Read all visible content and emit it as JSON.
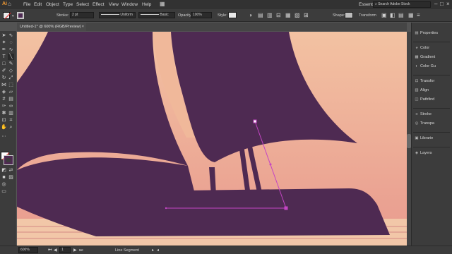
{
  "menubar": {
    "items": [
      "File",
      "Edit",
      "Object",
      "Type",
      "Select",
      "Effect",
      "View",
      "Window",
      "Help"
    ],
    "workspace": "Essentials",
    "search_placeholder": "Search Adobe Stock"
  },
  "control_bar": {
    "stroke_label": "Stroke:",
    "stroke_weight": "2 pt",
    "profile": "Uniform",
    "brush": "Basic",
    "opacity_label": "Opacity:",
    "opacity_value": "100%",
    "style_label": "Style:",
    "shape_label": "Shape:",
    "transform_label": "Transform"
  },
  "document": {
    "tab_title": "Untitled-1* @ 600% (RGB/Preview)"
  },
  "panels": {
    "items": [
      {
        "icon": "properties-icon",
        "label": "Properties"
      },
      {
        "icon": "color-icon",
        "label": "Color"
      },
      {
        "icon": "gradient-icon",
        "label": "Gradient"
      },
      {
        "icon": "color-guide-icon",
        "label": "Color Gu"
      },
      {
        "icon": "transform-icon",
        "label": "Transfor"
      },
      {
        "icon": "align-icon",
        "label": "Align"
      },
      {
        "icon": "pathfinder-icon",
        "label": "Pathfind"
      },
      {
        "icon": "stroke-icon",
        "label": "Stroke"
      },
      {
        "icon": "transparency-icon",
        "label": "Transpa"
      },
      {
        "icon": "libraries-icon",
        "label": "Librarie"
      },
      {
        "icon": "layers-icon",
        "label": "Layers"
      }
    ]
  },
  "statusbar": {
    "zoom": "600%",
    "page": "1",
    "tool_hint": "Line Segment"
  },
  "colors": {
    "ship": "#4e2a52",
    "sky_top": "#f3c2a2",
    "sky_bottom": "#e89a8e",
    "selection": "#c445c4"
  }
}
